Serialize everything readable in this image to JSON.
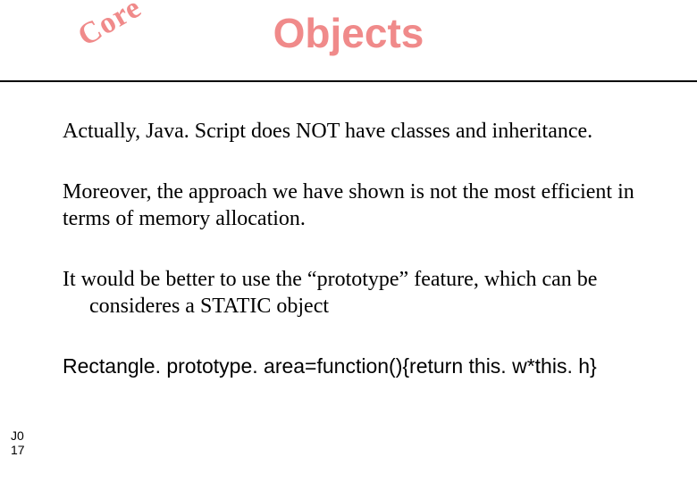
{
  "header": {
    "core_label": "Core",
    "title": "Objects"
  },
  "body": {
    "p1": "Actually, Java. Script does NOT have classes and inheritance.",
    "p2": "Moreover, the approach we have shown is not the most efficient in terms of memory allocation.",
    "p3": "It would be better to use the “prototype” feature, which can be consideres a STATIC object",
    "p4": "Rectangle. prototype. area=function(){return this. w*this. h}"
  },
  "footer": {
    "line1": "J0",
    "line2": "17"
  }
}
